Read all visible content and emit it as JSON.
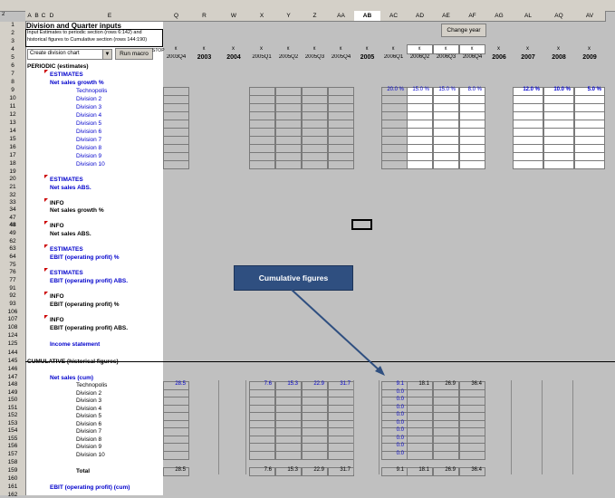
{
  "col_headers": [
    "A",
    "B",
    "C",
    "D",
    "E",
    "Q",
    "R",
    "W",
    "X",
    "Y",
    "Z",
    "AA",
    "AB",
    "AC",
    "AD",
    "AE",
    "AF",
    "AG",
    "AL",
    "AQ",
    "AV"
  ],
  "year_headers": [
    "2003Q4",
    "2003",
    "2004",
    "2005Q1",
    "2005Q2",
    "2005Q3",
    "2005Q4",
    "2005",
    "2006Q1",
    "2006Q2",
    "2006Q3",
    "2006Q4",
    "2006",
    "2007",
    "2008",
    "2009"
  ],
  "header": {
    "title": "Division and Quarter inputs",
    "instructions_1": "Input Estimates to periodic section (rows 6:142) and",
    "instructions_2": "historical figures to Cumulative section (rows 144:190)",
    "dropdown_value": "Create division chart",
    "run_macro_label": "Run macro",
    "change_year_label": "Change year",
    "stop_label": "STOP"
  },
  "rows": [
    {
      "num": "1"
    },
    {
      "num": "2"
    },
    {
      "num": "3"
    },
    {
      "num": "4"
    },
    {
      "num": "5"
    },
    {
      "num": "6",
      "label": "PERIODIC (estimates)"
    },
    {
      "num": "7",
      "label": "ESTIMATES"
    },
    {
      "num": "8",
      "label": "Net sales growth %"
    },
    {
      "num": "9",
      "label": "Technopolis"
    },
    {
      "num": "10",
      "label": "Division 2"
    },
    {
      "num": "11",
      "label": "Division 3"
    },
    {
      "num": "12",
      "label": "Division 4"
    },
    {
      "num": "13",
      "label": "Division 5"
    },
    {
      "num": "14",
      "label": "Division 6"
    },
    {
      "num": "15",
      "label": "Division 7"
    },
    {
      "num": "16",
      "label": "Division 8"
    },
    {
      "num": "17",
      "label": "Division 9"
    },
    {
      "num": "18",
      "label": "Division 10"
    },
    {
      "num": "19"
    },
    {
      "num": "20",
      "label": "ESTIMATES"
    },
    {
      "num": "21",
      "label": "Net sales ABS."
    },
    {
      "num": "32"
    },
    {
      "num": "33",
      "label": "INFO"
    },
    {
      "num": "34",
      "label": "Net sales growth %"
    },
    {
      "num": "47"
    },
    {
      "num": "48",
      "label": "INFO"
    },
    {
      "num": "49",
      "label": "Net sales ABS."
    },
    {
      "num": "62"
    },
    {
      "num": "63",
      "label": "ESTIMATES"
    },
    {
      "num": "64",
      "label": "EBIT (operating profit) %"
    },
    {
      "num": "75"
    },
    {
      "num": "76",
      "label": "ESTIMATES"
    },
    {
      "num": "77",
      "label": "EBIT (operating profit) ABS."
    },
    {
      "num": "91"
    },
    {
      "num": "92",
      "label": "INFO"
    },
    {
      "num": "93",
      "label": "EBIT (operating profit) %"
    },
    {
      "num": "106"
    },
    {
      "num": "107",
      "label": "INFO"
    },
    {
      "num": "108",
      "label": "EBIT (operating profit) ABS."
    },
    {
      "num": "124"
    },
    {
      "num": "125",
      "label": "Income statement"
    },
    {
      "num": "144"
    },
    {
      "num": "145",
      "label": "CUMULATIVE (historical figures)"
    },
    {
      "num": "146"
    },
    {
      "num": "147",
      "label": "Net sales (cum)"
    },
    {
      "num": "148",
      "label": "Technopolis"
    },
    {
      "num": "149",
      "label": "Division 2"
    },
    {
      "num": "150",
      "label": "Division 3"
    },
    {
      "num": "151",
      "label": "Division 4"
    },
    {
      "num": "152",
      "label": "Division 5"
    },
    {
      "num": "153",
      "label": "Division 6"
    },
    {
      "num": "154",
      "label": "Division 7"
    },
    {
      "num": "155",
      "label": "Division 8"
    },
    {
      "num": "156",
      "label": "Division 9"
    },
    {
      "num": "157",
      "label": "Division 10"
    },
    {
      "num": "158"
    },
    {
      "num": "159",
      "label": "Total"
    },
    {
      "num": "160"
    },
    {
      "num": "161",
      "label": "EBIT (operating profit) (cum)"
    },
    {
      "num": "162"
    }
  ],
  "growth_row": {
    "q2006": [
      "20.0 %",
      "15.0 %",
      "15.0 %",
      "8.0 %"
    ],
    "years": [
      "12.0 %",
      "10.0 %",
      "5.0 %"
    ]
  },
  "cum_row": {
    "q2003q4": "28.5",
    "q2005": [
      "7.6",
      "15.3",
      "22.9",
      "31.7"
    ],
    "q2006": [
      "9.1",
      "18.1",
      "26.9",
      "36.4"
    ]
  },
  "zeros": [
    "0.0",
    "0.0",
    "0.0",
    "0.0",
    "0.0",
    "0.0",
    "0.0",
    "0.0",
    "0.0"
  ],
  "total_row": {
    "q2003q4": "28.5",
    "q2005": [
      "7.6",
      "15.3",
      "22.9",
      "31.7"
    ],
    "q2006": [
      "9.1",
      "18.1",
      "26.9",
      "36.4"
    ]
  },
  "callout": "Cumulative figures"
}
